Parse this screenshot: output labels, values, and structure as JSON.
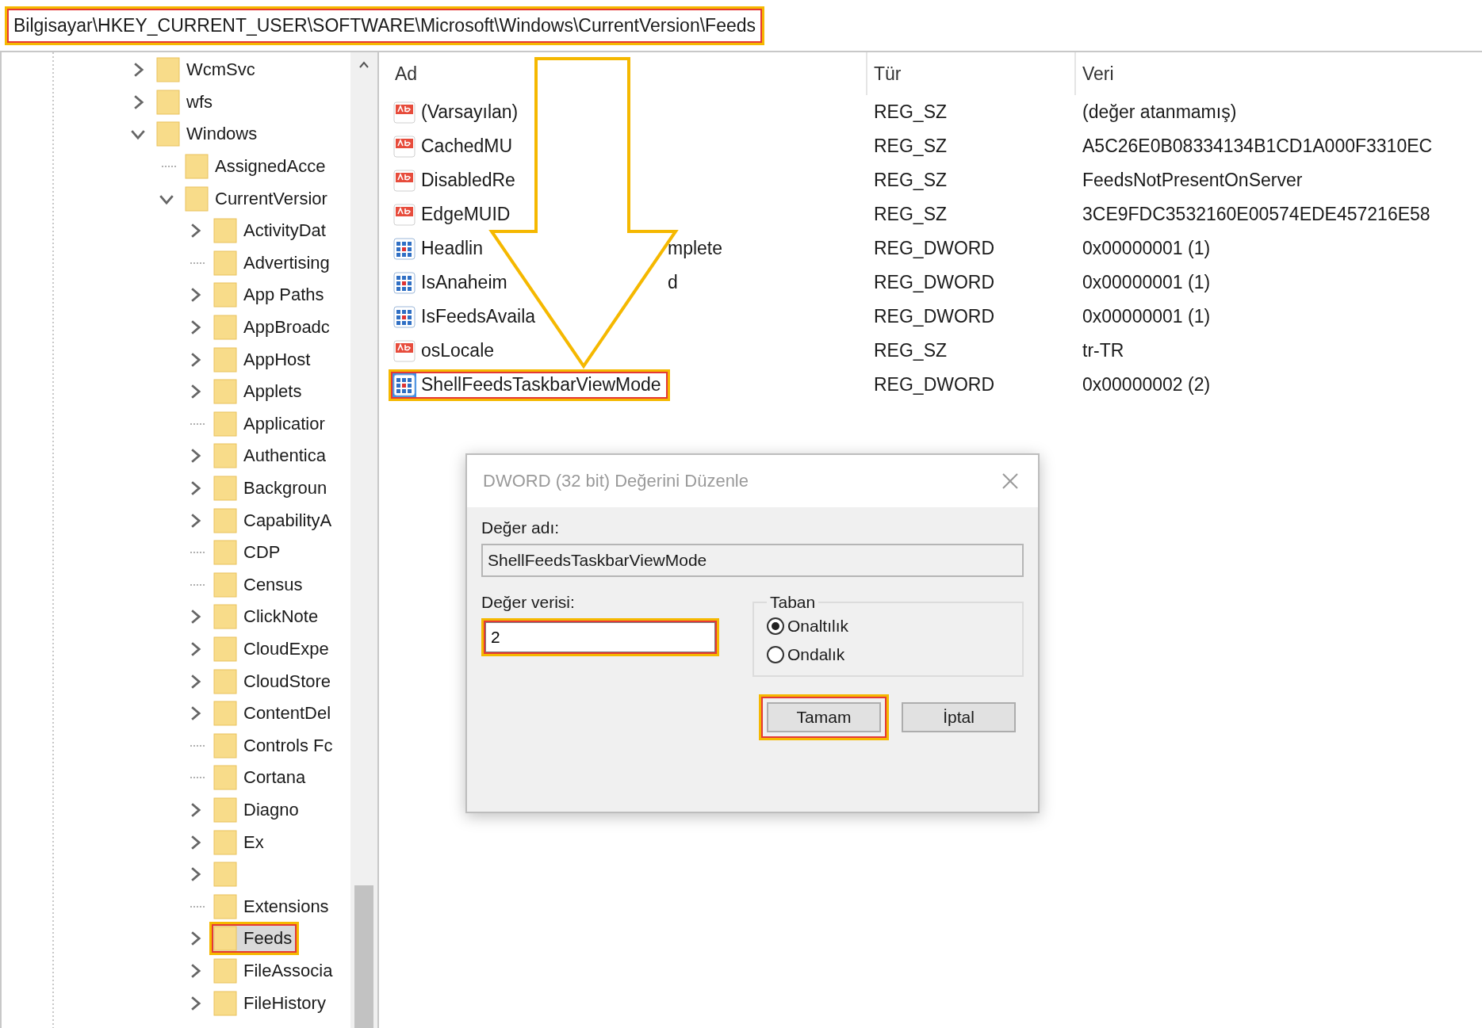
{
  "address_bar": {
    "path": "Bilgisayar\\HKEY_CURRENT_USER\\SOFTWARE\\Microsoft\\Windows\\CurrentVersion\\Feeds",
    "highlighted": true
  },
  "tree": [
    {
      "name": "WcmSvc",
      "has_children": true,
      "expanded": false,
      "selected": false,
      "highlighted": false
    },
    {
      "name": "wfs",
      "has_children": true,
      "expanded": false,
      "selected": false,
      "highlighted": false
    },
    {
      "name": "Windows",
      "has_children": true,
      "expanded": true,
      "selected": false,
      "highlighted": false,
      "children": [
        {
          "name": "AssignedAcce",
          "has_children": false,
          "selected": false,
          "highlighted": false
        },
        {
          "name": "CurrentVersior",
          "has_children": true,
          "expanded": true,
          "selected": false,
          "highlighted": false,
          "children": [
            {
              "name": "ActivityDat",
              "has_children": true,
              "expanded": false,
              "selected": false,
              "highlighted": false
            },
            {
              "name": "Advertising",
              "has_children": false,
              "selected": false,
              "highlighted": false
            },
            {
              "name": "App Paths",
              "has_children": true,
              "expanded": false,
              "selected": false,
              "highlighted": false
            },
            {
              "name": "AppBroadc",
              "has_children": true,
              "expanded": false,
              "selected": false,
              "highlighted": false
            },
            {
              "name": "AppHost",
              "has_children": true,
              "expanded": false,
              "selected": false,
              "highlighted": false
            },
            {
              "name": "Applets",
              "has_children": true,
              "expanded": false,
              "selected": false,
              "highlighted": false
            },
            {
              "name": "Applicatior",
              "has_children": false,
              "selected": false,
              "highlighted": false
            },
            {
              "name": "Authentica",
              "has_children": true,
              "expanded": false,
              "selected": false,
              "highlighted": false
            },
            {
              "name": "Backgroun",
              "has_children": true,
              "expanded": false,
              "selected": false,
              "highlighted": false
            },
            {
              "name": "CapabilityA",
              "has_children": true,
              "expanded": false,
              "selected": false,
              "highlighted": false
            },
            {
              "name": "CDP",
              "has_children": false,
              "selected": false,
              "highlighted": false
            },
            {
              "name": "Census",
              "has_children": false,
              "selected": false,
              "highlighted": false
            },
            {
              "name": "ClickNote",
              "has_children": true,
              "expanded": false,
              "selected": false,
              "highlighted": false
            },
            {
              "name": "CloudExpe",
              "has_children": true,
              "expanded": false,
              "selected": false,
              "highlighted": false
            },
            {
              "name": "CloudStore",
              "has_children": true,
              "expanded": false,
              "selected": false,
              "highlighted": false
            },
            {
              "name": "ContentDel",
              "has_children": true,
              "expanded": false,
              "selected": false,
              "highlighted": false
            },
            {
              "name": "Controls Fc",
              "has_children": false,
              "selected": false,
              "highlighted": false
            },
            {
              "name": "Cortana",
              "has_children": false,
              "selected": false,
              "highlighted": false
            },
            {
              "name": "Diagno",
              "has_children": true,
              "expanded": false,
              "selected": false,
              "highlighted": false
            },
            {
              "name": "Ex",
              "has_children": true,
              "expanded": false,
              "selected": false,
              "highlighted": false
            },
            {
              "has_children": true,
              "expanded": false,
              "selected": false,
              "highlighted": false
            },
            {
              "name": "Extensions",
              "has_children": false,
              "selected": false,
              "highlighted": false
            },
            {
              "name": "Feeds",
              "has_children": true,
              "expanded": false,
              "selected": true,
              "highlighted": true
            },
            {
              "name": "FileAssocia",
              "has_children": true,
              "expanded": false,
              "selected": false,
              "highlighted": false
            },
            {
              "name": "FileHistory",
              "has_children": true,
              "expanded": false,
              "selected": false,
              "highlighted": false
            }
          ]
        }
      ]
    }
  ],
  "values": {
    "columns": [
      "Ad",
      "Tür",
      "Veri"
    ],
    "rows": [
      {
        "kind": "string",
        "name": "(Varsayılan)",
        "type": "REG_SZ",
        "data": "(değer atanmamış)",
        "selected": false,
        "highlighted": false
      },
      {
        "kind": "string",
        "name": "CachedMU",
        "type": "REG_SZ",
        "data": "A5C26E0B08334134B1CD1A000F3310EC",
        "selected": false,
        "highlighted": false
      },
      {
        "kind": "string",
        "name": "DisabledRe",
        "type": "REG_SZ",
        "data": "FeedsNotPresentOnServer",
        "selected": false,
        "highlighted": false
      },
      {
        "kind": "string",
        "name": "EdgeMUID",
        "type": "REG_SZ",
        "data": "3CE9FDC3532160E00574EDE457216E58",
        "selected": false,
        "highlighted": false
      },
      {
        "kind": "dword",
        "name": "Headlin",
        "name_tail": "mplete",
        "type": "REG_DWORD",
        "data": "0x00000001 (1)",
        "selected": false,
        "highlighted": false
      },
      {
        "kind": "dword",
        "name": "IsAnaheim",
        "name_tail": "d",
        "type": "REG_DWORD",
        "data": "0x00000001 (1)",
        "selected": false,
        "highlighted": false
      },
      {
        "kind": "dword",
        "name": "IsFeedsAvaila",
        "type": "REG_DWORD",
        "data": "0x00000001 (1)",
        "selected": false,
        "highlighted": false
      },
      {
        "kind": "string",
        "name": "osLocale",
        "type": "REG_SZ",
        "data": "tr-TR",
        "selected": false,
        "highlighted": false
      },
      {
        "kind": "dword",
        "name": "ShellFeedsTaskbarViewMode",
        "type": "REG_DWORD",
        "data": "0x00000002 (2)",
        "selected": true,
        "highlighted": true
      }
    ]
  },
  "dialog": {
    "title": "DWORD (32 bit) Değerini Düzenle",
    "name_label": "Değer adı:",
    "name_value": "ShellFeedsTaskbarViewMode",
    "data_label": "Değer verisi:",
    "data_value": "2",
    "data_highlighted": true,
    "base_label": "Taban",
    "base_options": [
      {
        "label": "Onaltılık",
        "selected": true
      },
      {
        "label": "Ondalık",
        "selected": false
      }
    ],
    "buttons": [
      {
        "label": "Tamam",
        "highlighted": true
      },
      {
        "label": "İptal",
        "highlighted": false
      }
    ]
  }
}
